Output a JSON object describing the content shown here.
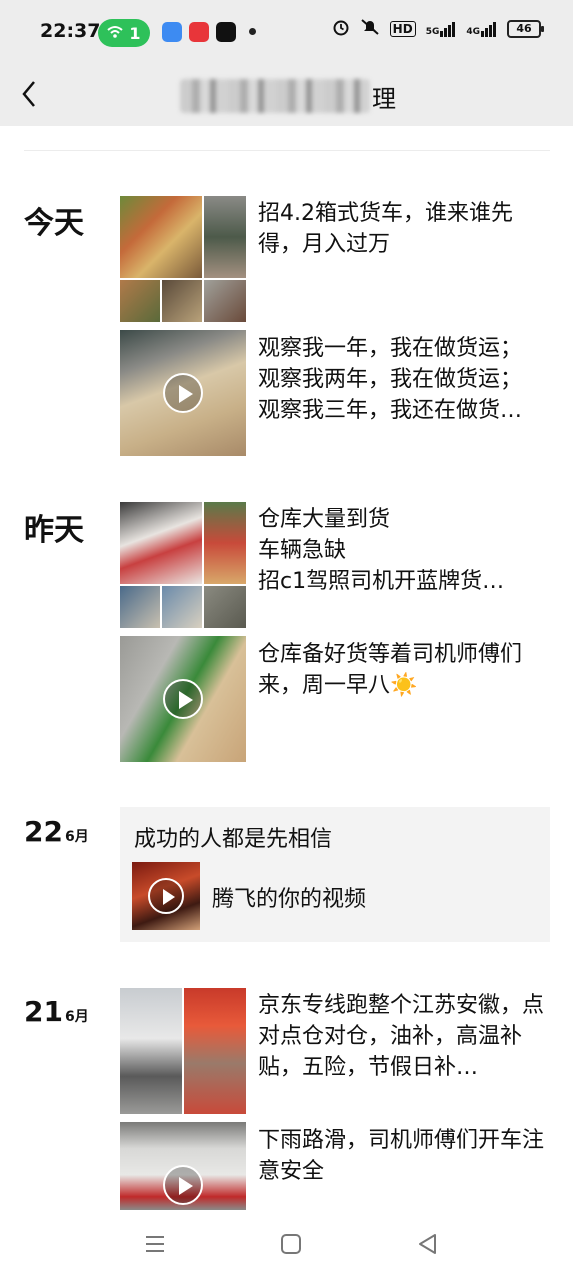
{
  "status_bar": {
    "time": "22:37",
    "wifi_count": "1",
    "battery": "46",
    "signal_labels": [
      "HD",
      "5G",
      "4G"
    ]
  },
  "nav": {
    "title_visible_suffix": "理"
  },
  "days": [
    {
      "label": "今天",
      "posts": [
        {
          "type": "images",
          "text": "招4.2箱式货车，谁来谁先得，月入过万"
        },
        {
          "type": "video",
          "text": "观察我一年，我在做货运；\n观察我两年，我在做货运；\n观察我三年，我还在做货…"
        }
      ]
    },
    {
      "label": "昨天",
      "posts": [
        {
          "type": "images",
          "text": "仓库大量到货\n车辆急缺\n招c1驾照司机开蓝牌货…"
        },
        {
          "type": "video",
          "text": "仓库备好货等着司机师傅们来，周一早八☀️"
        }
      ]
    },
    {
      "day": "22",
      "month": "6月",
      "share": {
        "title": "成功的人都是先相信",
        "video_caption": "腾飞的你的视频"
      }
    },
    {
      "day": "21",
      "month": "6月",
      "posts": [
        {
          "type": "images",
          "text": "京东专线跑整个江苏安徽，点对点仓对仓，油补，高温补贴，五险，节假日补…"
        },
        {
          "type": "video",
          "text": "下雨路滑，司机师傅们开车注意安全"
        }
      ]
    }
  ],
  "colors": {
    "wifi_pill": "#2ec15a",
    "header_bg": "#ededed",
    "card_bg": "#f3f3f3"
  }
}
